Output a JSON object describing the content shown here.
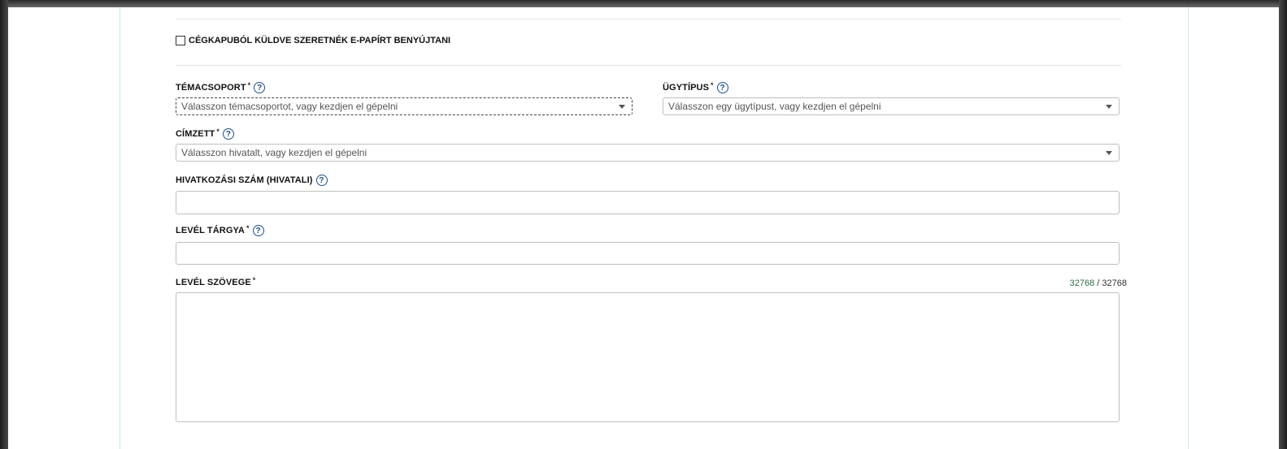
{
  "form": {
    "checkbox_label": "CÉGKAPUBÓL KÜLDVE SZERETNÉK E-PAPÍRT BENYÚJTANI",
    "temacsoport": {
      "label": "TÉMACSOPORT",
      "required": "*",
      "placeholder": "Válasszon témacsoportot, vagy kezdjen el gépelni"
    },
    "ugytipus": {
      "label": "ÜGYTÍPUS",
      "required": "*",
      "placeholder": "Válasszon egy ügytípust, vagy kezdjen el gépelni"
    },
    "cimzett": {
      "label": "CÍMZETT",
      "required": "*",
      "placeholder": "Válasszon hivatalt, vagy kezdjen el gépelni"
    },
    "hivatkozasi": {
      "label": "HIVATKOZÁSI SZÁM (HIVATALI)",
      "value": ""
    },
    "targy": {
      "label": "LEVÉL TÁRGYA",
      "required": "*",
      "value": ""
    },
    "szoveg": {
      "label": "LEVÉL SZÖVEGE",
      "required": "*",
      "value": "",
      "counter_used": "32768",
      "counter_sep": " / ",
      "counter_max": "32768"
    },
    "help_glyph": "?"
  },
  "icons": [
    "help-icon",
    "chevron-down-icon",
    "checkbox-icon"
  ],
  "colors": {
    "accent": "#1f4f8a",
    "counter_green": "#2f6f3f",
    "card_border": "#cfe6ea"
  }
}
